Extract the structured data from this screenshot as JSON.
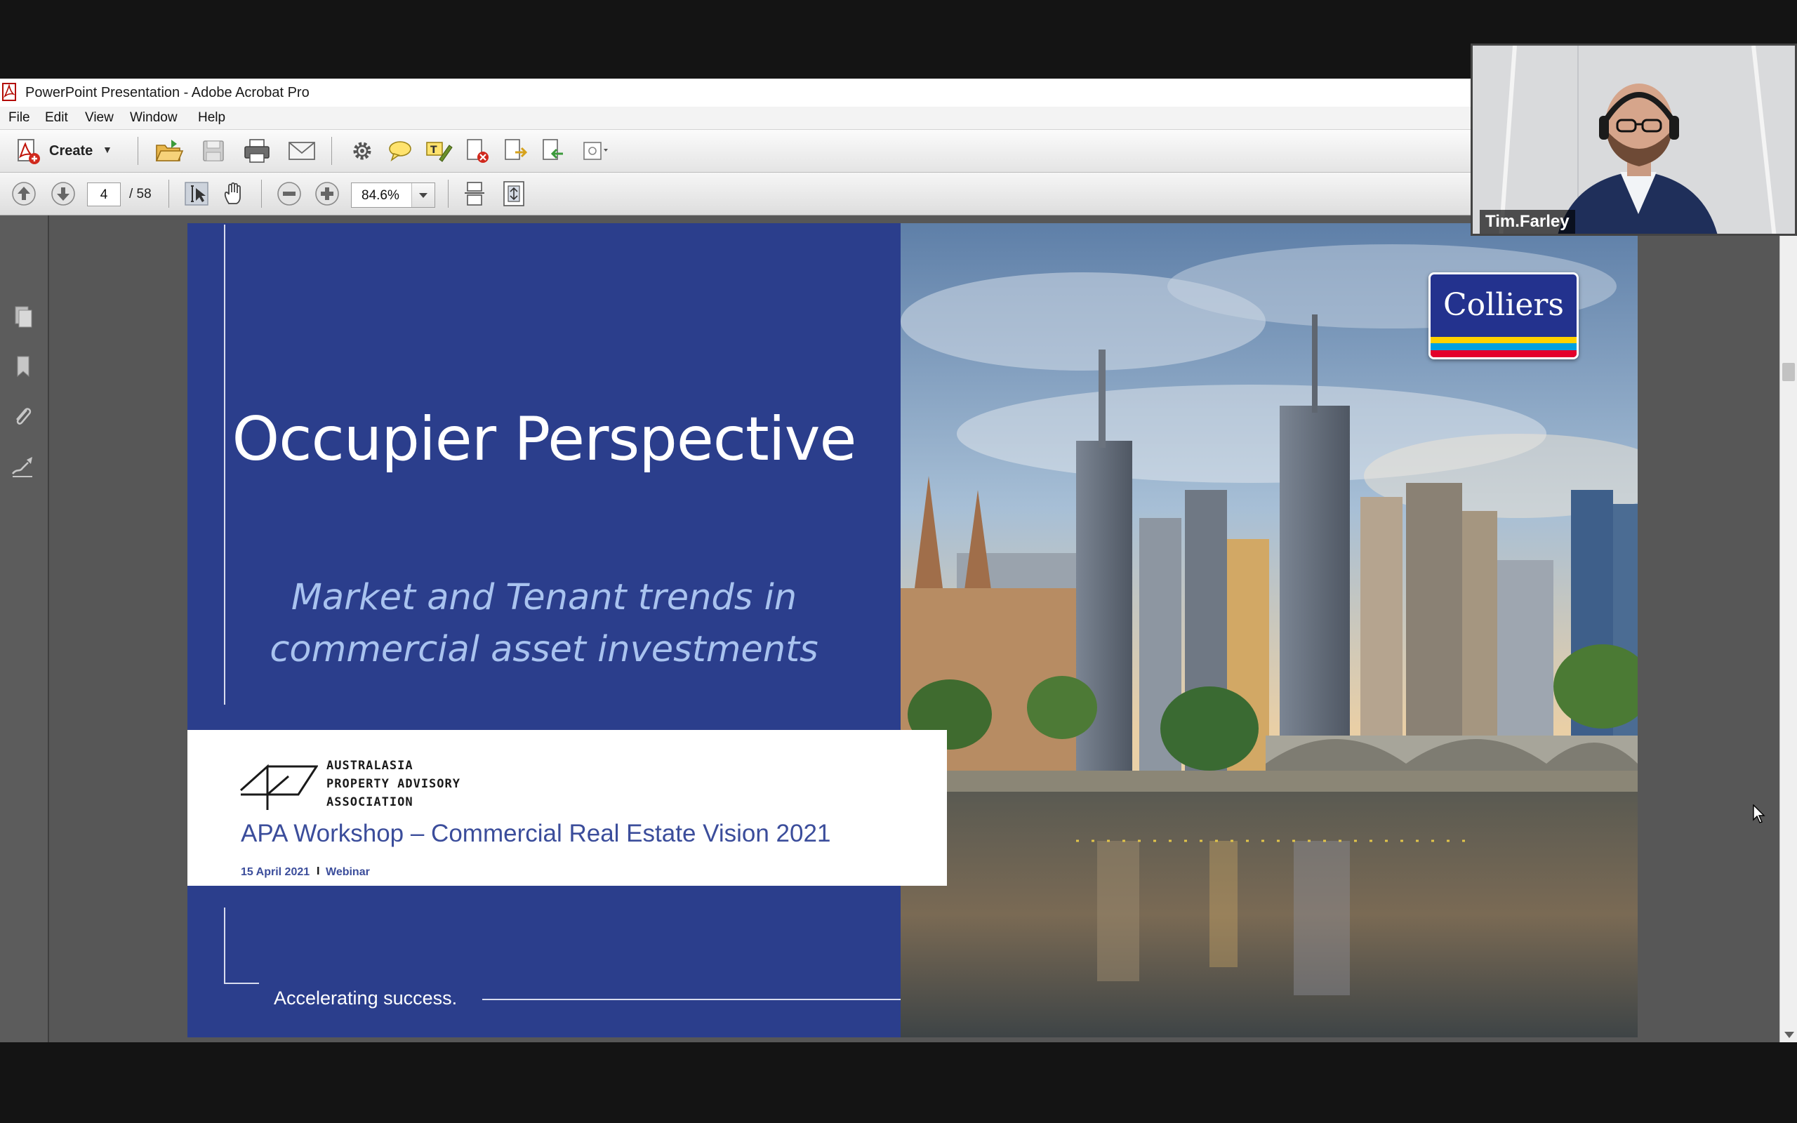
{
  "window": {
    "title": "PowerPoint Presentation - Adobe Acrobat Pro"
  },
  "menu": [
    "File",
    "Edit",
    "View",
    "Window",
    "Help"
  ],
  "toolbar": {
    "create_label": "Create",
    "icons": [
      "open-folder-icon",
      "save-icon",
      "print-icon",
      "email-icon",
      "settings-icon",
      "comment-icon",
      "highlight-icon",
      "delete-page-icon",
      "export-icon",
      "import-icon",
      "review-icon"
    ]
  },
  "navigation": {
    "current_page": "4",
    "page_total": "/ 58",
    "zoom": "84.6%"
  },
  "nav_pane_icons": [
    "pages-icon",
    "bookmark-icon",
    "attachment-icon",
    "signature-icon"
  ],
  "slide": {
    "title": "Occupier Perspective",
    "subtitle_line1": "Market and Tenant trends in",
    "subtitle_line2": "commercial asset investments",
    "org_line1": "AUSTRALASIA",
    "org_line2": "PROPERTY ADVISORY",
    "org_line3": "ASSOCIATION",
    "event_title": "APA Workshop – Commercial Real Estate Vision 2021",
    "event_date": "15 April 2021",
    "event_separator": "I",
    "event_format": "Webinar",
    "tagline": "Accelerating success.",
    "brand_logo": "Colliers",
    "brand_colors": {
      "navy": "#23328e",
      "yellow": "#ffd200",
      "blue": "#00a0e1",
      "red": "#e4002b"
    }
  },
  "video": {
    "participant_name": "Tim.Farley"
  },
  "colors": {
    "slide_blue": "#2b3e8c",
    "accent_text": "#a9c3ef",
    "event_text": "#3b4d9b",
    "doc_background": "#575757"
  }
}
